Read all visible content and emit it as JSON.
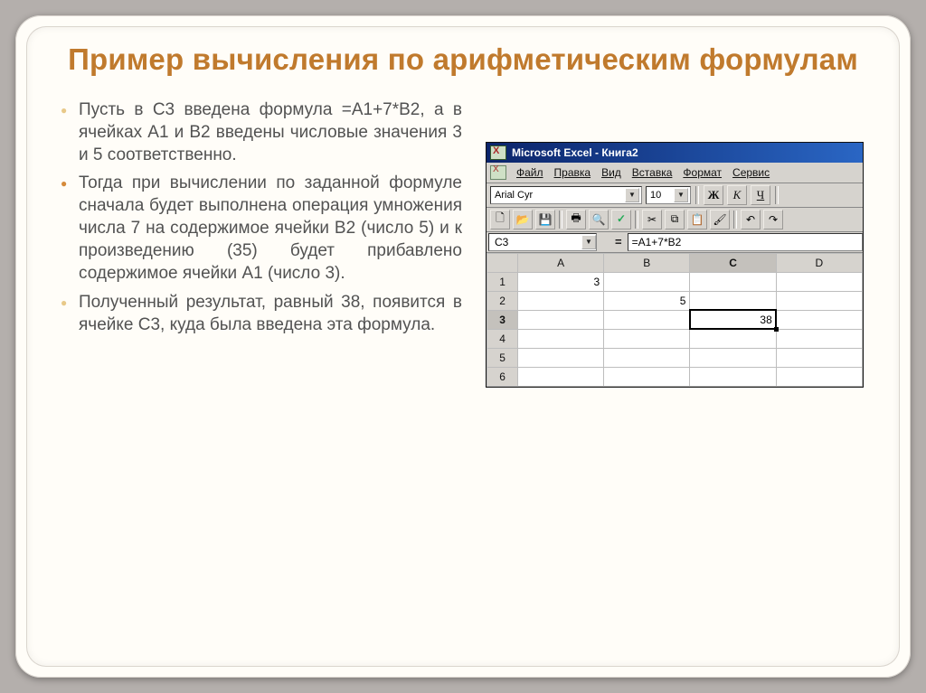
{
  "title": "Пример вычисления по арифметическим формулам",
  "bullets": [
    "Пусть в С3 введена формула =А1+7*В2, а в ячейках А1 и В2 введены числовые значения 3 и 5 соответственно.",
    "Тогда при вычислении по заданной формуле сначала будет выполнена операция умножения числа 7 на содержимое ячейки В2 (число 5) и к произведению (35) будет прибавлено содержимое ячейки А1 (число 3).",
    "Полученный результат, равный 38, появится в ячейке С3, куда была введена эта формула."
  ],
  "excel": {
    "window_title": "Microsoft Excel - Книга2",
    "menus": [
      "Файл",
      "Правка",
      "Вид",
      "Вставка",
      "Формат",
      "Сервис"
    ],
    "font_name": "Arial Cyr",
    "font_size": "10",
    "btn_bold": "Ж",
    "btn_italic": "К",
    "btn_underline": "Ч",
    "namebox": "C3",
    "equals": "=",
    "formula": "=A1+7*B2",
    "columns": [
      "A",
      "B",
      "C",
      "D"
    ],
    "rows": [
      "1",
      "2",
      "3",
      "4",
      "5",
      "6"
    ],
    "cells": {
      "A1": "3",
      "B2": "5",
      "C3": "38"
    },
    "active_col": "C",
    "active_row": "3"
  }
}
